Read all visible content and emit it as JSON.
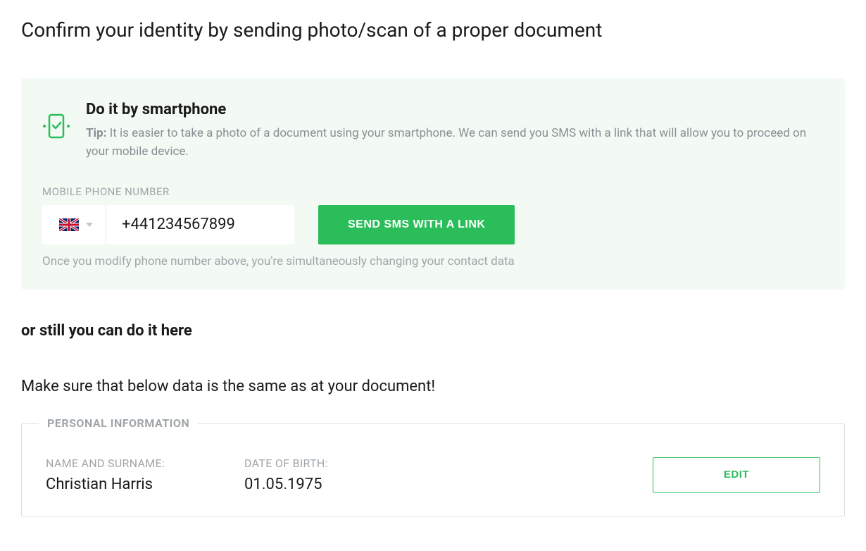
{
  "page_title": "Confirm your identity by sending photo/scan of a proper document",
  "tip_panel": {
    "title": "Do it by smartphone",
    "tip_prefix": "Tip:",
    "description": " It is easier to take a photo of a document using your smartphone. We can send you SMS with a link that will allow you to proceed on your mobile device.",
    "phone_field_label": "MOBILE PHONE NUMBER",
    "phone_country": "UK",
    "phone_value": "+441234567899",
    "send_button": "SEND SMS WITH A LINK",
    "phone_note": "Once you modify phone number above, you're simultaneously changing your contact data"
  },
  "alt_heading": "or still you can do it here",
  "warn_text": "Make sure that below data is the same as at your document!",
  "personal_info": {
    "legend": "PERSONAL INFORMATION",
    "name_label": "NAME AND SURNAME:",
    "name_value": "Christian Harris",
    "dob_label": "DATE OF BIRTH:",
    "dob_value": "01.05.1975",
    "edit_button": "EDIT"
  }
}
